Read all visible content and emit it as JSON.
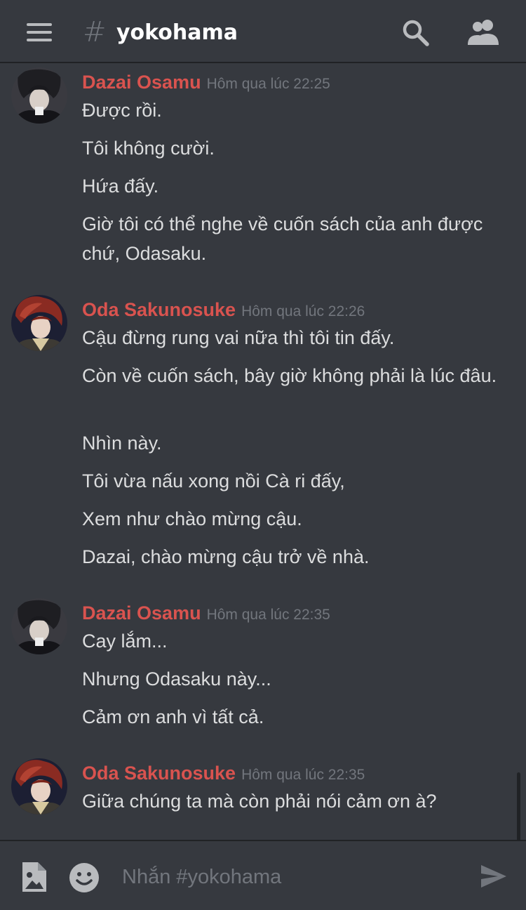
{
  "header": {
    "channel_hash": "#",
    "channel_name": "yokohama"
  },
  "messages": [
    {
      "author": "Dazai Osamu",
      "timestamp": "Hôm qua lúc 22:25",
      "lines": [
        "Được rồi.",
        "Tôi không cười.",
        "Hứa đấy.",
        "Giờ tôi có thể nghe về cuốn sách của anh được chứ, Odasaku."
      ]
    },
    {
      "author": "Oda Sakunosuke",
      "timestamp": "Hôm qua lúc 22:26",
      "lines": [
        "Cậu đừng rung vai nữa thì tôi tin đấy.",
        "Còn về cuốn sách, bây giờ không phải là lúc đâu.",
        "Nhìn này.",
        "Tôi vừa nấu xong nồi Cà ri đấy,",
        "Xem như chào mừng cậu.",
        "Dazai, chào mừng cậu trở về nhà."
      ]
    },
    {
      "author": "Dazai Osamu",
      "timestamp": "Hôm qua lúc 22:35",
      "lines": [
        "Cay lắm...",
        "Nhưng Odasaku này...",
        "Cảm ơn anh vì tất cả."
      ]
    },
    {
      "author": "Oda Sakunosuke",
      "timestamp": "Hôm qua lúc 22:35",
      "lines": [
        "Giữa chúng ta mà còn phải nói cảm ơn à?"
      ]
    }
  ],
  "composer": {
    "placeholder": "Nhắn #yokohama"
  },
  "colors": {
    "background": "#36393f",
    "author_name": "#d9534f",
    "timestamp": "#72767d",
    "message_text": "#dcddde"
  },
  "icons": [
    "menu-icon",
    "hash-icon",
    "search-icon",
    "members-icon",
    "image-upload-icon",
    "emoji-icon",
    "send-icon"
  ]
}
